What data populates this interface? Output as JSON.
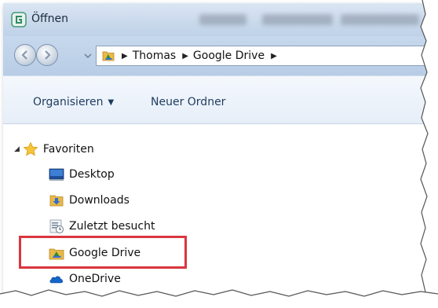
{
  "window": {
    "title": "Öffnen"
  },
  "address_bar": {
    "crumbs": [
      "Thomas",
      "Google Drive"
    ]
  },
  "toolbar": {
    "organize_label": "Organisieren",
    "new_folder_label": "Neuer Ordner"
  },
  "navigation": {
    "favorites_label": "Favoriten",
    "items": [
      {
        "label": "Desktop",
        "icon": "desktop-icon"
      },
      {
        "label": "Downloads",
        "icon": "downloads-folder-icon"
      },
      {
        "label": "Zuletzt besucht",
        "icon": "recent-places-icon"
      },
      {
        "label": "Google Drive",
        "icon": "google-drive-icon"
      },
      {
        "label": "OneDrive",
        "icon": "onedrive-icon"
      }
    ]
  },
  "colors": {
    "highlight": "#d9363e",
    "toolbar_text": "#1e3b5e",
    "chrome_blue": "#c6d8ec"
  }
}
